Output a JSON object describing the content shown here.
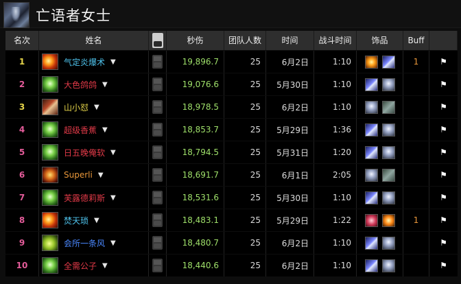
{
  "boss": {
    "title": "亡语者女士",
    "icon": "boss-portrait"
  },
  "headers": {
    "rank": "名次",
    "name": "姓名",
    "video": "YouTube",
    "dps": "秒伤",
    "raid_size": "团队人数",
    "date": "时间",
    "fight_time": "战斗时间",
    "trinkets": "饰品",
    "buff": "Buff"
  },
  "rows": [
    {
      "rank": "1",
      "name": "气定炎爆术",
      "dps": "19,896.7",
      "size": "25",
      "date": "6月2日",
      "time": "1:10",
      "buff": "1"
    },
    {
      "rank": "2",
      "name": "大色鸽鸽",
      "dps": "19,076.6",
      "size": "25",
      "date": "5月30日",
      "time": "1:10",
      "buff": ""
    },
    {
      "rank": "3",
      "name": "山小怼",
      "dps": "18,978.5",
      "size": "25",
      "date": "6月2日",
      "time": "1:10",
      "buff": ""
    },
    {
      "rank": "4",
      "name": "超级香蕉",
      "dps": "18,853.7",
      "size": "25",
      "date": "5月29日",
      "time": "1:36",
      "buff": ""
    },
    {
      "rank": "5",
      "name": "日五晚俺软",
      "dps": "18,794.5",
      "size": "25",
      "date": "5月31日",
      "time": "1:20",
      "buff": ""
    },
    {
      "rank": "6",
      "name": "Superli",
      "dps": "18,691.7",
      "size": "25",
      "date": "6月1日",
      "time": "2:05",
      "buff": ""
    },
    {
      "rank": "7",
      "name": "芙露德莉斯",
      "dps": "18,531.6",
      "size": "25",
      "date": "5月30日",
      "time": "1:10",
      "buff": ""
    },
    {
      "rank": "8",
      "name": "焚天琐",
      "dps": "18,483.1",
      "size": "25",
      "date": "5月29日",
      "time": "1:22",
      "buff": "1"
    },
    {
      "rank": "9",
      "name": "会所一条风",
      "dps": "18,480.7",
      "size": "25",
      "date": "6月2日",
      "time": "1:10",
      "buff": ""
    },
    {
      "rank": "10",
      "name": "全需公子",
      "dps": "18,440.6",
      "size": "25",
      "date": "6月2日",
      "time": "1:10",
      "buff": ""
    }
  ],
  "colors": {
    "rank_first": "#e6d54a",
    "rank_other": "#e45c9a",
    "dps": "#9fe06a",
    "buff": "#e9973a"
  }
}
